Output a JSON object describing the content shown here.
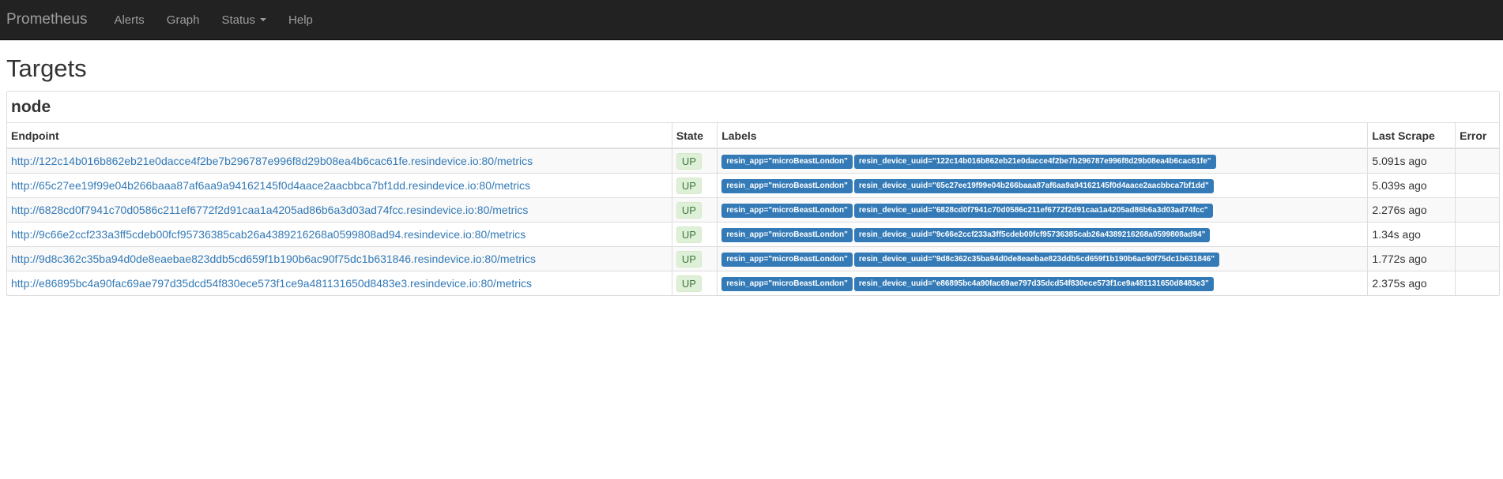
{
  "nav": {
    "brand": "Prometheus",
    "items": [
      "Alerts",
      "Graph",
      "Status",
      "Help"
    ]
  },
  "page_title": "Targets",
  "job": {
    "name": "node",
    "headers": [
      "Endpoint",
      "State",
      "Labels",
      "Last Scrape",
      "Error"
    ],
    "rows": [
      {
        "endpoint": "http://122c14b016b862eb21e0dacce4f2be7b296787e996f8d29b08ea4b6cac61fe.resindevice.io:80/metrics",
        "state": "UP",
        "label_app": "resin_app=\"microBeastLondon\"",
        "label_uuid": "resin_device_uuid=\"122c14b016b862eb21e0dacce4f2be7b296787e996f8d29b08ea4b6cac61fe\"",
        "last_scrape": "5.091s ago",
        "error": ""
      },
      {
        "endpoint": "http://65c27ee19f99e04b266baaa87af6aa9a94162145f0d4aace2aacbbca7bf1dd.resindevice.io:80/metrics",
        "state": "UP",
        "label_app": "resin_app=\"microBeastLondon\"",
        "label_uuid": "resin_device_uuid=\"65c27ee19f99e04b266baaa87af6aa9a94162145f0d4aace2aacbbca7bf1dd\"",
        "last_scrape": "5.039s ago",
        "error": ""
      },
      {
        "endpoint": "http://6828cd0f7941c70d0586c211ef6772f2d91caa1a4205ad86b6a3d03ad74fcc.resindevice.io:80/metrics",
        "state": "UP",
        "label_app": "resin_app=\"microBeastLondon\"",
        "label_uuid": "resin_device_uuid=\"6828cd0f7941c70d0586c211ef6772f2d91caa1a4205ad86b6a3d03ad74fcc\"",
        "last_scrape": "2.276s ago",
        "error": ""
      },
      {
        "endpoint": "http://9c66e2ccf233a3ff5cdeb00fcf95736385cab26a4389216268a0599808ad94.resindevice.io:80/metrics",
        "state": "UP",
        "label_app": "resin_app=\"microBeastLondon\"",
        "label_uuid": "resin_device_uuid=\"9c66e2ccf233a3ff5cdeb00fcf95736385cab26a4389216268a0599808ad94\"",
        "last_scrape": "1.34s ago",
        "error": ""
      },
      {
        "endpoint": "http://9d8c362c35ba94d0de8eaebae823ddb5cd659f1b190b6ac90f75dc1b631846.resindevice.io:80/metrics",
        "state": "UP",
        "label_app": "resin_app=\"microBeastLondon\"",
        "label_uuid": "resin_device_uuid=\"9d8c362c35ba94d0de8eaebae823ddb5cd659f1b190b6ac90f75dc1b631846\"",
        "last_scrape": "1.772s ago",
        "error": ""
      },
      {
        "endpoint": "http://e86895bc4a90fac69ae797d35dcd54f830ece573f1ce9a481131650d8483e3.resindevice.io:80/metrics",
        "state": "UP",
        "label_app": "resin_app=\"microBeastLondon\"",
        "label_uuid": "resin_device_uuid=\"e86895bc4a90fac69ae797d35dcd54f830ece573f1ce9a481131650d8483e3\"",
        "last_scrape": "2.375s ago",
        "error": ""
      }
    ]
  }
}
